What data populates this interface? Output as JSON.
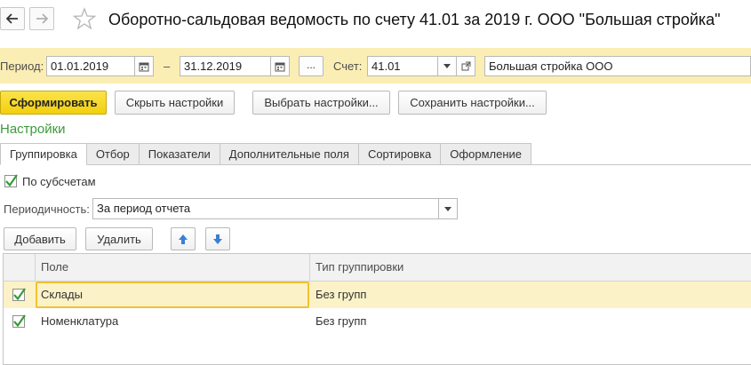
{
  "window": {
    "title": "Оборотно-сальдовая ведомость по счету 41.01 за 2019 г. ООО \"Большая стройка\""
  },
  "period_bar": {
    "period_label": "Период:",
    "date_from": "01.01.2019",
    "dash": "–",
    "date_to": "31.12.2019",
    "dots_label": "...",
    "account_label": "Счет:",
    "account_value": "41.01",
    "organization_value": "Большая стройка ООО"
  },
  "toolbar": {
    "generate_label": "Сформировать",
    "hide_settings_label": "Скрыть настройки",
    "choose_settings_label": "Выбрать настройки...",
    "save_settings_label": "Сохранить настройки..."
  },
  "settings": {
    "title": "Настройки",
    "tabs": [
      {
        "label": "Группировка",
        "active": true
      },
      {
        "label": "Отбор",
        "active": false
      },
      {
        "label": "Показатели",
        "active": false
      },
      {
        "label": "Дополнительные поля",
        "active": false
      },
      {
        "label": "Сортировка",
        "active": false
      },
      {
        "label": "Оформление",
        "active": false
      }
    ],
    "by_subaccounts_label": "По субсчетам",
    "by_subaccounts_checked": true,
    "periodicity_label": "Периодичность:",
    "periodicity_value": "За период отчета",
    "add_label": "Добавить",
    "delete_label": "Удалить"
  },
  "grouping_table": {
    "columns": [
      "Поле",
      "Тип группировки"
    ],
    "rows": [
      {
        "checked": true,
        "field": "Склады",
        "type": "Без групп",
        "selected": true
      },
      {
        "checked": true,
        "field": "Номенклатура",
        "type": "Без групп",
        "selected": false
      }
    ]
  },
  "colors": {
    "period_bar_bg": "#fbeeb4",
    "primary_button": "#f5d31c",
    "settings_title": "#3b9b3b",
    "selected_row": "#fcf2c8",
    "focus_border": "#f0c234",
    "arrow_blue": "#3a7fd5",
    "check_green": "#3a9a3a"
  },
  "icons": {
    "back": "arrow-left-icon",
    "forward": "arrow-right-icon",
    "favorite": "star-icon",
    "calendar": "calendar-icon",
    "dropdown": "chevron-down-icon",
    "open": "open-form-icon",
    "move_up": "arrow-up-icon",
    "move_down": "arrow-down-icon",
    "check": "checkmark-icon"
  }
}
